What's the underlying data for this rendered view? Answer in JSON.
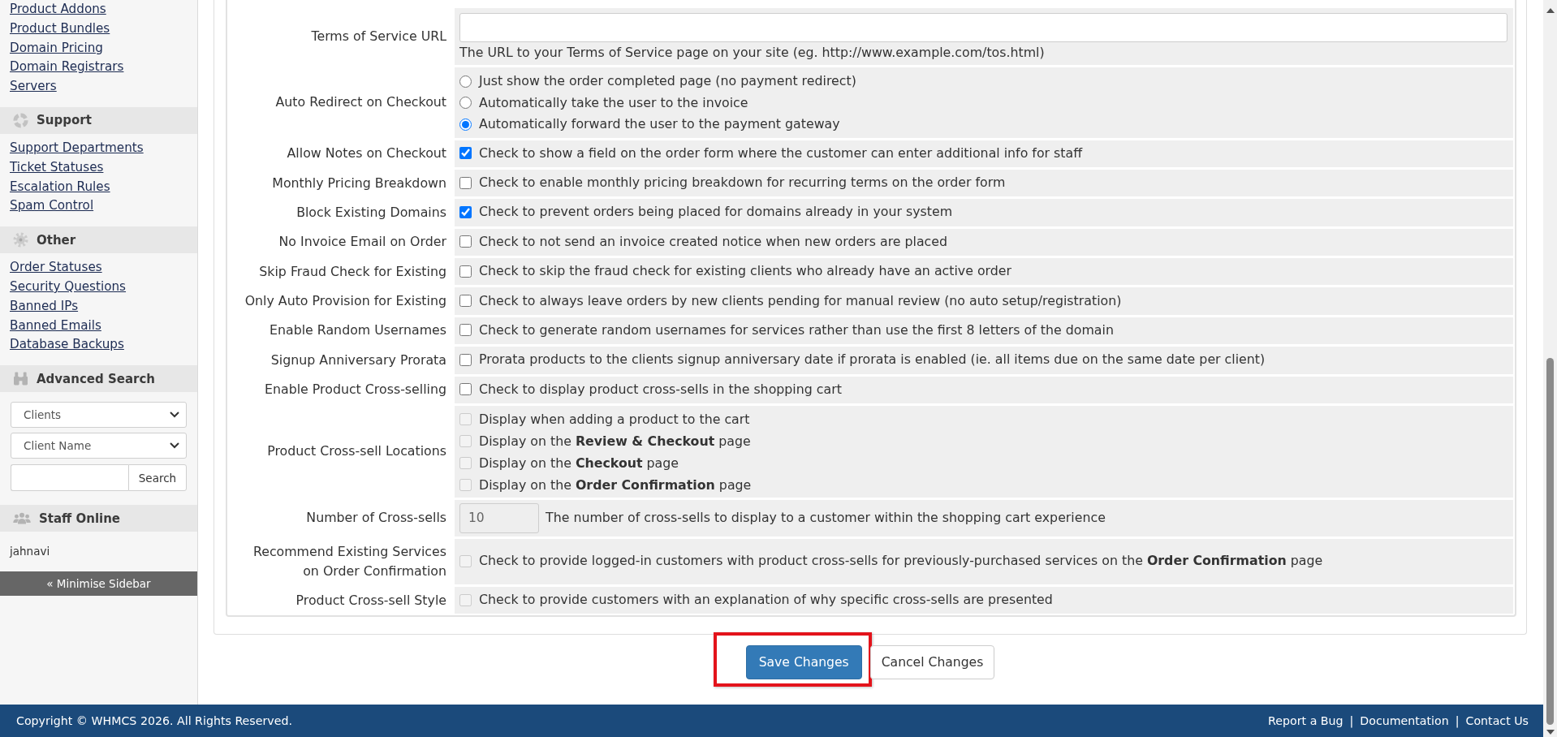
{
  "sidebar": {
    "links": [
      "Product Addons",
      "Product Bundles",
      "Domain Pricing",
      "Domain Registrars",
      "Servers"
    ],
    "support": {
      "title": "Support",
      "links": [
        "Support Departments",
        "Ticket Statuses",
        "Escalation Rules",
        "Spam Control"
      ]
    },
    "other": {
      "title": "Other",
      "links": [
        "Order Statuses",
        "Security Questions",
        "Banned IPs",
        "Banned Emails",
        "Database Backups"
      ]
    },
    "advanced_search": {
      "title": "Advanced Search",
      "selects": [
        "Clients",
        "Client Name"
      ],
      "button": "Search"
    },
    "staff_online": {
      "title": "Staff Online",
      "users": [
        "jahnavi"
      ]
    },
    "minimise": "« Minimise Sidebar"
  },
  "form": {
    "rows": [
      {
        "kind": "text",
        "label": "Terms of Service URL",
        "help": "The URL to your Terms of Service page on your site (eg. http://www.example.com/tos.html)"
      },
      {
        "kind": "radios",
        "label": "Auto Redirect on Checkout",
        "options": [
          {
            "text": "Just show the order completed page (no payment redirect)",
            "selected": false
          },
          {
            "text": "Automatically take the user to the invoice",
            "selected": false
          },
          {
            "text": "Automatically forward the user to the payment gateway",
            "selected": true
          }
        ]
      },
      {
        "kind": "checkbox",
        "label": "Allow Notes on Checkout",
        "text": "Check to show a field on the order form where the customer can enter additional info for staff",
        "checked": true,
        "disabled": false
      },
      {
        "kind": "checkbox",
        "label": "Monthly Pricing Breakdown",
        "text": "Check to enable monthly pricing breakdown for recurring terms on the order form",
        "checked": false,
        "disabled": false
      },
      {
        "kind": "checkbox",
        "label": "Block Existing Domains",
        "text": "Check to prevent orders being placed for domains already in your system",
        "checked": true,
        "disabled": false
      },
      {
        "kind": "checkbox",
        "label": "No Invoice Email on Order",
        "text": "Check to not send an invoice created notice when new orders are placed",
        "checked": false,
        "disabled": false
      },
      {
        "kind": "checkbox",
        "label": "Skip Fraud Check for Existing",
        "text": "Check to skip the fraud check for existing clients who already have an active order",
        "checked": false,
        "disabled": false
      },
      {
        "kind": "checkbox",
        "label": "Only Auto Provision for Existing",
        "text": "Check to always leave orders by new clients pending for manual review (no auto setup/registration)",
        "checked": false,
        "disabled": false
      },
      {
        "kind": "checkbox",
        "label": "Enable Random Usernames",
        "text": "Check to generate random usernames for services rather than use the first 8 letters of the domain",
        "checked": false,
        "disabled": false
      },
      {
        "kind": "checkbox",
        "label": "Signup Anniversary Prorata",
        "text": "Prorata products to the clients signup anniversary date if prorata is enabled (ie. all items due on the same date per client)",
        "checked": false,
        "disabled": false
      },
      {
        "kind": "checkbox",
        "label": "Enable Product Cross-selling",
        "text": "Check to display product cross-sells in the shopping cart",
        "checked": false,
        "disabled": false
      },
      {
        "kind": "checkboxes",
        "label": "Product Cross-sell Locations",
        "options": [
          {
            "text": "Display when adding a product to the cart",
            "checked": false,
            "disabled": true
          },
          {
            "text": "Display on the **Review & Checkout** page",
            "checked": false,
            "disabled": true
          },
          {
            "text": "Display on the **Checkout** page",
            "checked": false,
            "disabled": true
          },
          {
            "text": "Display on the **Order Confirmation** page",
            "checked": false,
            "disabled": true
          }
        ]
      },
      {
        "kind": "number",
        "label": "Number of Cross-sells",
        "value": "10",
        "disabled": true,
        "help": "The number of cross-sells to display to a customer within the shopping cart experience"
      },
      {
        "kind": "checkbox",
        "label": "Recommend Existing Services on Order Confirmation",
        "text": "Check to provide logged-in customers with product cross-sells for previously-purchased services on the **Order Confirmation** page",
        "checked": false,
        "disabled": true
      },
      {
        "kind": "checkbox",
        "label": "Product Cross-sell Style",
        "text": "Check to provide customers with an explanation of why specific cross-sells are presented",
        "checked": false,
        "disabled": true
      }
    ]
  },
  "buttons": [
    {
      "label": "Save Changes",
      "kind": "primary",
      "highlighted": true
    },
    {
      "label": "Cancel Changes",
      "kind": "default",
      "highlighted": false
    }
  ],
  "footer": {
    "copyright": "Copyright © WHMCS 2026. All Rights Reserved.",
    "separator": "|",
    "links": [
      "Report a Bug",
      "Documentation",
      "Contact Us"
    ]
  }
}
